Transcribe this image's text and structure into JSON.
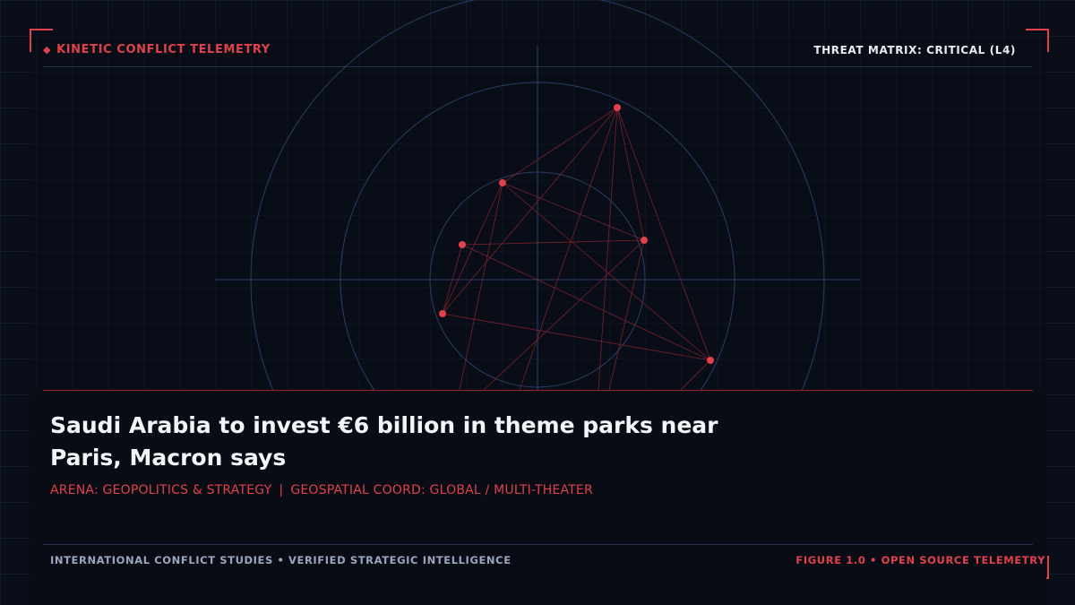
{
  "header": {
    "left_label": "KINETIC CONFLICT TELEMETRY",
    "left_icon": "diamond-icon",
    "right_label": "THREAT MATRIX: CRITICAL (L4)"
  },
  "article": {
    "headline": "Saudi Arabia to invest €6 billion in theme parks near Paris, Macron says",
    "arena": "ARENA: GEOPOLITICS & STRATEGY",
    "separator": "|",
    "coord": "GEOSPATIAL COORD: GLOBAL / MULTI-THEATER"
  },
  "footer": {
    "left": "INTERNATIONAL CONFLICT STUDIES • VERIFIED STRATEGIC INTELLIGENCE",
    "right": "FIGURE 1.0 • OPEN SOURCE TELEMETRY"
  },
  "colors": {
    "accent": "#e0414a",
    "background": "#0a0e18",
    "grid": "#1c2a44",
    "ring": "#2b3d66",
    "text": "#f3f5f9"
  }
}
